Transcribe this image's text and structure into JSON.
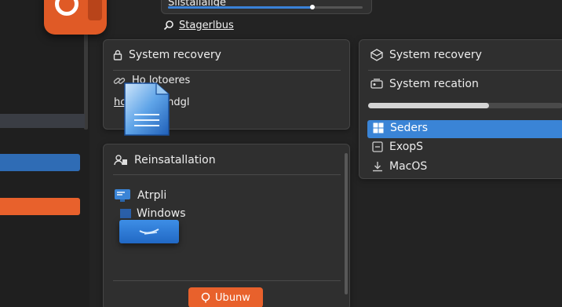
{
  "top": {
    "title": "Sllstallaiige",
    "progress": 0.74,
    "search_label": "Stagerlbus"
  },
  "recovery_card": {
    "title": "System recovery",
    "line1": "Ho lotoeres",
    "line2_prefix": "hc",
    "line2_suffix": "sandgl"
  },
  "reinstall_card": {
    "title": "Reinsatallation",
    "item1": "Atrpli",
    "item2": "Windows",
    "button_label": "Ubunw"
  },
  "right_panel": {
    "title": "System recovery",
    "subtitle": "System recation",
    "progress": 0.62,
    "options": [
      {
        "label": "Seders",
        "icon": "windows-icon",
        "selected": true
      },
      {
        "label": "ExopS",
        "icon": "box-icon",
        "selected": false
      },
      {
        "label": "MacOS",
        "icon": "download-icon",
        "selected": false
      }
    ]
  },
  "colors": {
    "accent_blue": "#3a84d6",
    "accent_orange": "#e8612c",
    "background": "#232323",
    "card": "#2f2f2f"
  }
}
